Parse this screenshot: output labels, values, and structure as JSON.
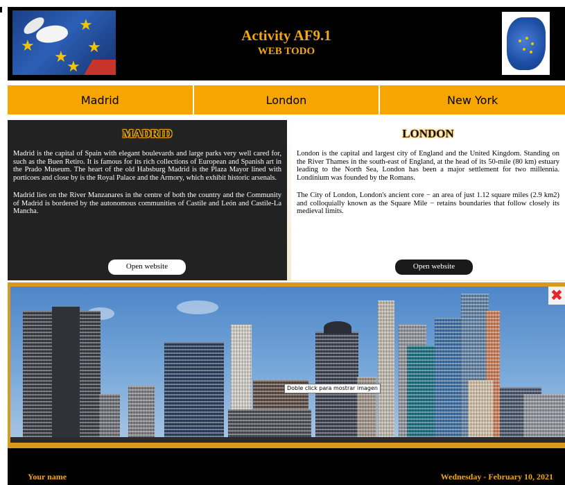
{
  "header": {
    "title": "Activity AF9.1",
    "subtitle": "WEB TODO"
  },
  "tabs": [
    {
      "label": "Madrid"
    },
    {
      "label": "London"
    },
    {
      "label": "New York"
    }
  ],
  "madrid": {
    "heading": "MADRID",
    "paragraphs": [
      "Madrid is the capital of Spain with elegant boulevards and large parks very well cared for, such as the Buen Retiro. It is famous for its rich collections of European and Spanish art in the Prado Museum. The heart of the old Habsburg Madrid is the Plaza Mayor lined with porticoes and close by is the Royal Palace and the Armory, which exhibit historic arsenals.",
      "Madrid lies on the River Manzanares in the centre of both the country and the Community of Madrid is bordered by the autonomous communities of Castile and León and Castile-La Mancha."
    ],
    "button": "Open website"
  },
  "london": {
    "heading": "LONDON",
    "paragraphs": [
      "London is the capital and largest city of England and the United Kingdom. Standing on the River Thames in the south-east of England, at the head of its 50-mile (80 km) estuary leading to the North Sea, London has been a major settlement for two millennia. Londinium was founded by the Romans.",
      "The City of London, London's ancient core − an area of just 1.12 square miles (2.9 km2) and colloquially known as the Square Mile − retains boundaries that follow closely its medieval limits."
    ],
    "button": "Open website"
  },
  "image": {
    "tooltip": "Doble click para mostrar imagen",
    "close_icon": "close-icon"
  },
  "footer": {
    "name": "Your name",
    "date": "Wednesday - February 10, 2021"
  },
  "colors": {
    "accent": "#f0a90f",
    "tab_bg": "#f7a501",
    "dark_panel": "#222222",
    "header_bg": "#000000",
    "close": "#e8242b"
  }
}
